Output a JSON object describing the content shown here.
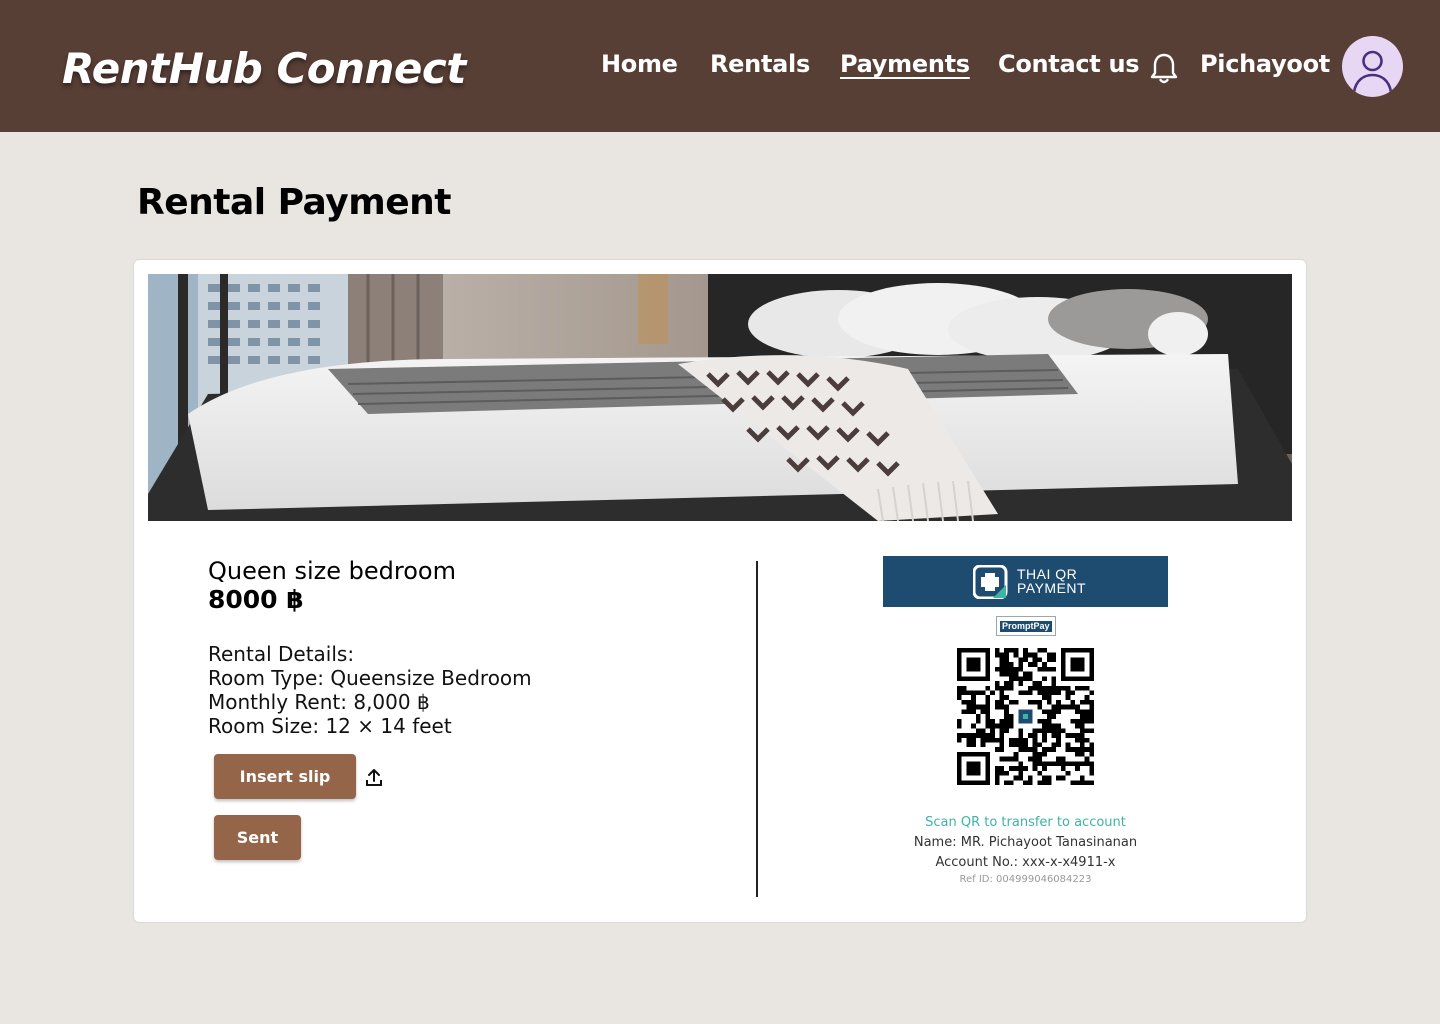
{
  "header": {
    "brand": "RentHub Connect",
    "nav": [
      {
        "label": "Home"
      },
      {
        "label": "Rentals"
      },
      {
        "label": "Payments"
      },
      {
        "label": "Contact us"
      }
    ],
    "user_name": "Pichayoot",
    "icons": {
      "notifications": "bell-icon",
      "avatar": "user-avatar-icon"
    }
  },
  "page": {
    "title": "Rental Payment"
  },
  "room": {
    "name": "Queen size bedroom",
    "price": "8000 ฿",
    "details": [
      "Rental Details:",
      "Room Type: Queensize Bedroom",
      "Monthly Rent: 8,000 ฿",
      "Room Size: 12 × 14 feet"
    ]
  },
  "actions": {
    "insert_slip": "Insert slip",
    "sent": "Sent",
    "upload_icon": "upload-icon"
  },
  "payment": {
    "banner_line1": "THAI QR",
    "banner_line2": "PAYMENT",
    "promptpay_label": "PromptPay",
    "scan_text": "Scan QR to transfer to account",
    "name": "Name: MR. Pichayoot Tanasinanan",
    "account": "Account No.: xxx-x-x4911-x",
    "ref": "Ref ID: 004999046084223"
  },
  "colors": {
    "header_bg": "#583f36",
    "page_bg": "#e9e6e1",
    "button": "#956549",
    "qr_banner": "#1e4c71",
    "scan_text": "#3fb3a6"
  }
}
